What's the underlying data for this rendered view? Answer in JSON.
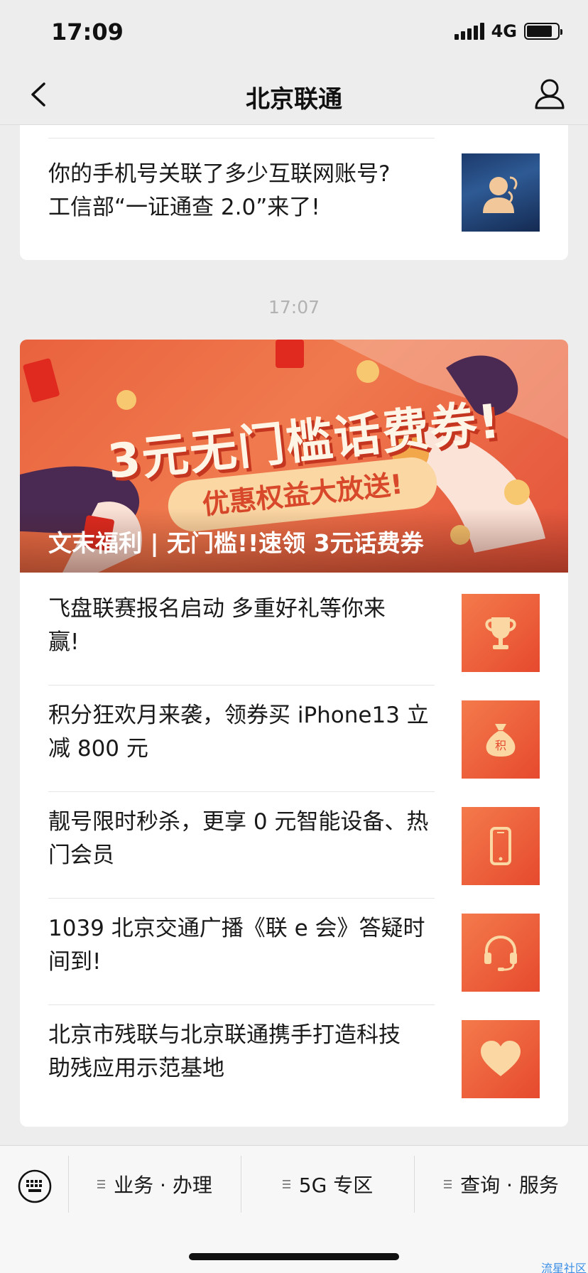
{
  "status_bar": {
    "time": "17:09",
    "network": "4G"
  },
  "nav": {
    "title": "北京联通"
  },
  "top_card": {
    "title_line1": "你的手机号关联了多少互联网账号?",
    "title_line2": "工信部“一证通查 2.0”来了!"
  },
  "timestamp": "17:07",
  "banner": {
    "headline": "3元无门槛话费券!",
    "pill": "优惠权益大放送!",
    "caption": "文末福利 | 无门槛!!速领 3元话费券"
  },
  "articles": [
    {
      "line1": "飞盘联赛报名启动 多重好礼等你来",
      "line2": "赢!",
      "icon": "trophy-icon"
    },
    {
      "line1": "积分狂欢月来袭，领券买 iPhone13 立",
      "line2": "减 800 元",
      "icon": "money-bag-icon",
      "icon_text": "积"
    },
    {
      "line1": "靓号限时秒杀，更享 0 元智能设备、热",
      "line2": "门会员",
      "icon": "phone-icon"
    },
    {
      "line1": "1039 北京交通广播《联 e 会》答疑时",
      "line2": "间到!",
      "icon": "headset-icon"
    },
    {
      "line1": "北京市残联与北京联通携手打造科技",
      "line2": "助残应用示范基地",
      "icon": "heart-icon"
    }
  ],
  "bottom_menu": {
    "items": [
      "业务 · 办理",
      "5G 专区",
      "查询 · 服务"
    ]
  },
  "watermark": "流星社区",
  "colors": {
    "accent_red": "#e64a2e",
    "background": "#ededed"
  }
}
